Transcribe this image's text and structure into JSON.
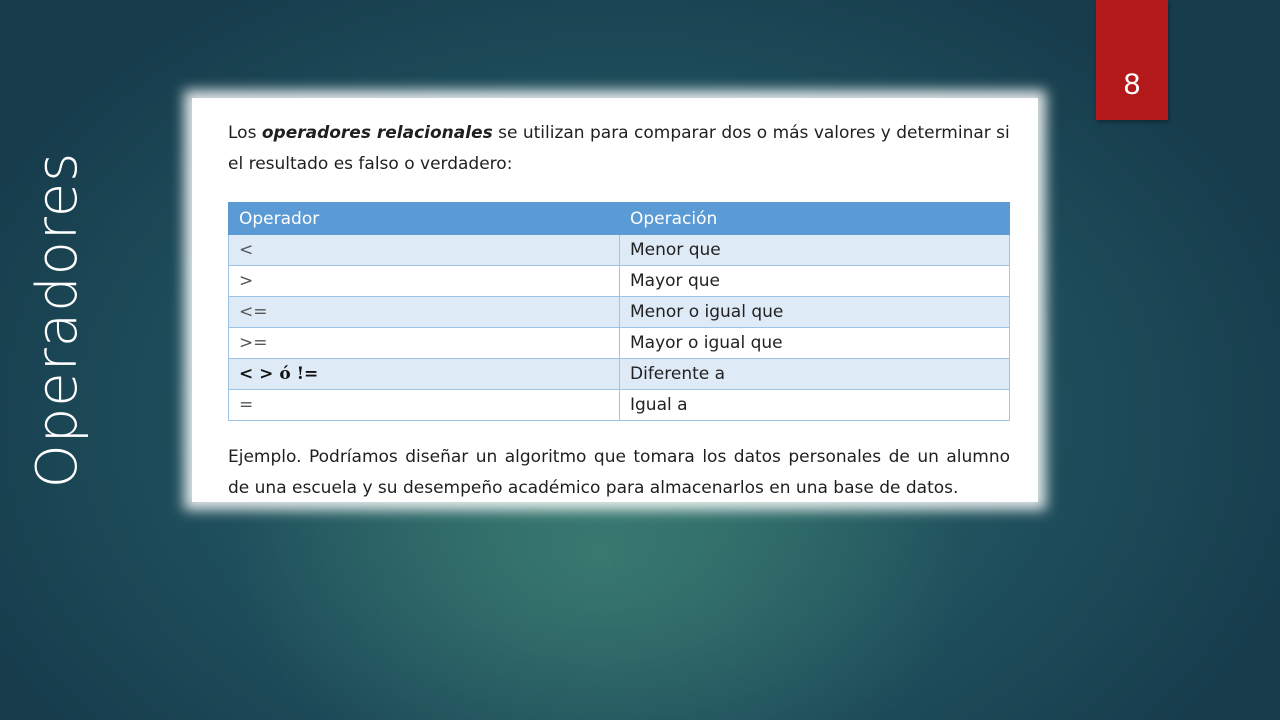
{
  "slide": {
    "title": "Operadores",
    "number": "8"
  },
  "document": {
    "intro_prefix": "Los ",
    "intro_bold": "operadores relacionales",
    "intro_suffix": " se utilizan para comparar dos o más valores y determinar si el resultado es falso o verdadero:",
    "table": {
      "headers": [
        "Operador",
        "Operación"
      ],
      "rows": [
        [
          "<",
          "Menor que"
        ],
        [
          ">",
          "Mayor que"
        ],
        [
          "<=",
          "Menor o igual que"
        ],
        [
          ">=",
          "Mayor o igual que"
        ],
        [
          "< >  ó !=",
          "Diferente a"
        ],
        [
          "=",
          "Igual a"
        ]
      ]
    },
    "example": "Ejemplo. Podríamos diseñar un algoritmo que tomara los datos personales de un alumno de una escuela y su desempeño académico para almacenarlos en una base de datos."
  },
  "colors": {
    "number_box": "#b3191a",
    "table_header": "#5b9bd5",
    "table_band": "#deeaf6"
  }
}
